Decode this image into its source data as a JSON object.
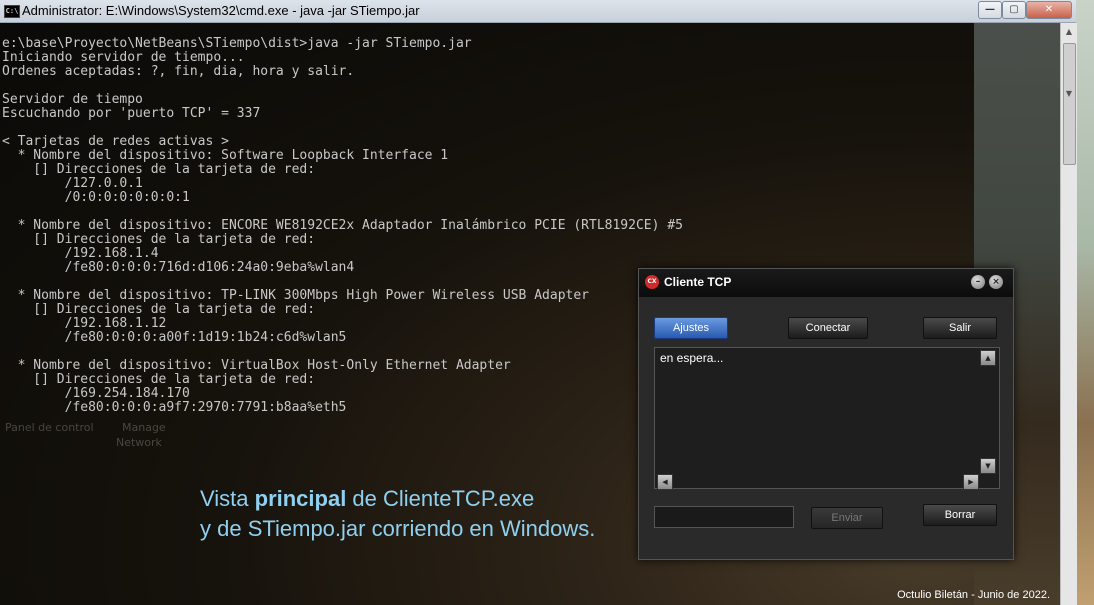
{
  "cmd_window": {
    "title": "Administrator: E:\\Windows\\System32\\cmd.exe - java  -jar STiempo.jar",
    "icon": "console-icon",
    "controls": {
      "minimize": "—",
      "maximize": "▢",
      "close": "✕"
    },
    "lines": [
      "e:\\base\\Proyecto\\NetBeans\\STiempo\\dist>java -jar STiempo.jar",
      "Iniciando servidor de tiempo...",
      "Ordenes aceptadas: ?, fin, dia, hora y salir.",
      "",
      "Servidor de tiempo",
      "Escuchando por 'puerto TCP' = 337",
      "",
      "< Tarjetas de redes activas >",
      "  * Nombre del dispositivo: Software Loopback Interface 1",
      "    [] Direcciones de la tarjeta de red:",
      "        /127.0.0.1",
      "        /0:0:0:0:0:0:0:1",
      "",
      "  * Nombre del dispositivo: ENCORE WE8192CE2x Adaptador Inalámbrico PCIE (RTL8192CE) #5",
      "    [] Direcciones de la tarjeta de red:",
      "        /192.168.1.4",
      "        /fe80:0:0:0:716d:d106:24a0:9eba%wlan4",
      "",
      "  * Nombre del dispositivo: TP-LINK 300Mbps High Power Wireless USB Adapter",
      "    [] Direcciones de la tarjeta de red:",
      "        /192.168.1.12",
      "        /fe80:0:0:0:a00f:1d19:1b24:c6d%wlan5",
      "",
      "  * Nombre del dispositivo: VirtualBox Host-Only Ethernet Adapter",
      "    [] Direcciones de la tarjeta de red:",
      "        /169.254.184.170",
      "        /fe80:0:0:0:a9f7:2970:7791:b8aa%eth5"
    ]
  },
  "tcp_window": {
    "title": "Cliente TCP",
    "logo": "CX",
    "buttons": {
      "ajustes": "Ajustes",
      "conectar": "Conectar",
      "salir": "Salir",
      "enviar": "Enviar",
      "borrar": "Borrar"
    },
    "output_text": "en espera...",
    "send_value": ""
  },
  "caption": {
    "line1_pre": "Vista ",
    "line1_bold": "principal",
    "line1_post": " de ClienteTCP.exe",
    "line2": "y de STiempo.jar corriendo en Windows."
  },
  "credit": "Octulio Biletán - Junio de 2022.",
  "desktop_icons": [
    "Panel de control",
    "Manage",
    "Network"
  ]
}
